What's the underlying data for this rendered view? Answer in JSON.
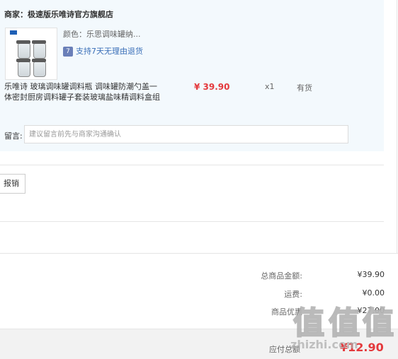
{
  "order": {
    "seller_label": "商家：",
    "seller_name": "极速版乐唯诗官方旗舰店",
    "product": {
      "color_label": "颜色：",
      "color_value": "乐思调味罐纳...",
      "return_badge": "7",
      "return_policy": "支持7天无理由退货",
      "title": "乐唯诗 玻璃调味罐调料瓶 调味罐防潮勺盖一体密封厨房调料罐子套装玻璃盐味精调料盒组",
      "price": "¥ 39.90",
      "quantity": "x1",
      "stock": "有货"
    },
    "remark_label": "留言:",
    "remark_placeholder": "建议留言前先与商家沟通确认"
  },
  "invoice": {
    "button_label": "报销"
  },
  "summary": {
    "total_label": "总商品金额:",
    "total_value": "¥39.90",
    "shipping_label": "运费:",
    "shipping_value": "¥0.00",
    "discount_label": "商品优惠",
    "discount_value": "-¥27.00"
  },
  "footer": {
    "pay_label": "应付总额",
    "pay_value": "¥12.90"
  },
  "watermark": {
    "glyph": "值",
    "text": "zhizhi.com"
  },
  "colors": {
    "accent": "#e4393c",
    "panel": "#f3f9fd",
    "link": "#3a6fb8"
  }
}
